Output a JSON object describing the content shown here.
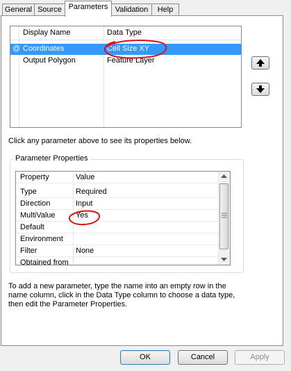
{
  "tabs": [
    "General",
    "Source",
    "Parameters",
    "Validation",
    "Help"
  ],
  "params_list": {
    "headers": {
      "name": "Display Name",
      "type": "Data Type"
    },
    "rows": [
      {
        "marker": "@",
        "name": "Coordinates",
        "type": "Cell Size XY"
      },
      {
        "marker": "",
        "name": "Output Polygon",
        "type": "Feature Layer"
      }
    ]
  },
  "hint_text": "Click any parameter above to see its properties below.",
  "group_title": "Parameter Properties",
  "properties": {
    "headers": {
      "property": "Property",
      "value": "Value"
    },
    "rows": [
      {
        "property": "Type",
        "value": "Required"
      },
      {
        "property": "Direction",
        "value": "Input"
      },
      {
        "property": "MultiValue",
        "value": "Yes"
      },
      {
        "property": "Default",
        "value": ""
      },
      {
        "property": "Environment",
        "value": ""
      },
      {
        "property": "Filter",
        "value": "None"
      },
      {
        "property": "Obtained from",
        "value": ""
      }
    ]
  },
  "instructions": [
    "To add a new parameter, type the name into an empty row in the",
    "name column, click in the Data Type column to choose a data type,",
    "then edit the Parameter Properties."
  ],
  "buttons": {
    "ok": "OK",
    "cancel": "Cancel",
    "apply": "Apply"
  },
  "colors": {
    "selection": "#3399ff",
    "annotation": "#e0101a"
  },
  "icons": {
    "up": "arrow-up-icon",
    "down": "arrow-down-icon",
    "grip": "scroll-grip-icon"
  }
}
